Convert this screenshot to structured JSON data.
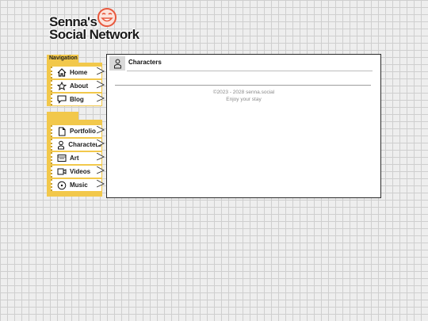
{
  "logo": {
    "line1": "Senna's",
    "line2": "Social Network"
  },
  "nav": {
    "heading": "Navigation",
    "items": [
      {
        "label": "Home",
        "icon": "home-icon"
      },
      {
        "label": "About",
        "icon": "star-icon"
      },
      {
        "label": "Blog",
        "icon": "chat-icon"
      }
    ]
  },
  "sections": {
    "heading": "",
    "items": [
      {
        "label": "Portfolio",
        "icon": "document-icon"
      },
      {
        "label": "Characters",
        "icon": "person-icon"
      },
      {
        "label": "Art",
        "icon": "image-icon"
      },
      {
        "label": "Videos",
        "icon": "video-icon"
      },
      {
        "label": "Music",
        "icon": "music-icon"
      }
    ]
  },
  "main": {
    "title": "Characters",
    "footer_copyright": "©2023 - 2028 senna.social",
    "footer_tagline": "Enjoy your stay"
  },
  "colors": {
    "nav_accent": "#f2c84b",
    "logo_accent": "#e8573c"
  }
}
